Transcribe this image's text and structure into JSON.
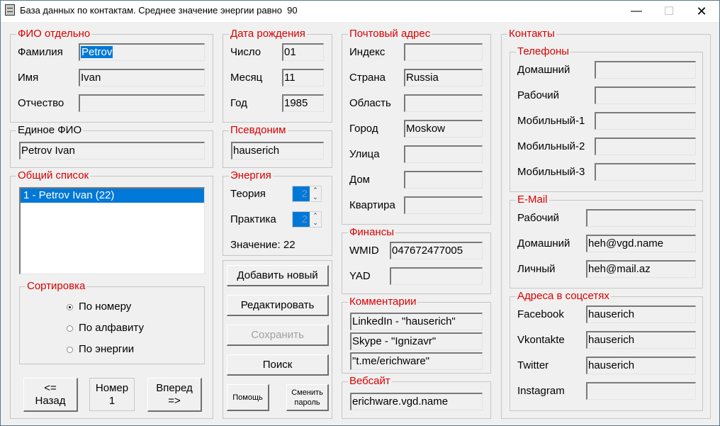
{
  "window": {
    "title": "База данных по контактам. Среднее значение энергии равно  90",
    "controls": {
      "minimize": "—",
      "maximize": "☐",
      "close": "✕"
    }
  },
  "fio": {
    "legend": "ФИО отдельно",
    "last_name_label": "Фамилия",
    "last_name_value": "Petrov",
    "first_name_label": "Имя",
    "first_name_value": "Ivan",
    "patronymic_label": "Отчество",
    "patronymic_value": ""
  },
  "full_name": {
    "legend": "Единое ФИО",
    "value": "Petrov Ivan"
  },
  "general_list": {
    "legend": "Общий список",
    "items": [
      "1 - Petrov Ivan (22)"
    ],
    "sort": {
      "legend": "Сортировка",
      "options": [
        "По номеру",
        "По алфавиту",
        "По энергии"
      ],
      "selected": "По номеру"
    },
    "nav": {
      "back": "<=\nНазад",
      "number_label": "Номер",
      "number_value": "1",
      "forward": "Вперед\n=>"
    }
  },
  "birth_date": {
    "legend": "Дата рождения",
    "day_label": "Число",
    "day_value": "01",
    "month_label": "Месяц",
    "month_value": "11",
    "year_label": "Год",
    "year_value": "1985"
  },
  "nickname": {
    "legend": "Псевдоним",
    "value": "hauserich"
  },
  "energy": {
    "legend": "Энергия",
    "theory_label": "Теория",
    "theory_value": "2",
    "practice_label": "Практика",
    "practice_value": "2",
    "result_text": "Значение: 22"
  },
  "actions": {
    "add": "Добавить новый",
    "edit": "Редактировать",
    "save": "Сохранить",
    "search": "Поиск",
    "help": "Помощь",
    "change_password": "Сменить пароль"
  },
  "postal": {
    "legend": "Почтовый адрес",
    "fields": [
      {
        "label": "Индекс",
        "value": ""
      },
      {
        "label": "Страна",
        "value": "Russia"
      },
      {
        "label": "Область",
        "value": ""
      },
      {
        "label": "Город",
        "value": "Moskow"
      },
      {
        "label": "Улица",
        "value": ""
      },
      {
        "label": "Дом",
        "value": ""
      },
      {
        "label": "Квартира",
        "value": ""
      }
    ]
  },
  "finance": {
    "legend": "Финансы",
    "fields": [
      {
        "label": "WMID",
        "value": "047672477005"
      },
      {
        "label": "YAD",
        "value": ""
      }
    ]
  },
  "comments": {
    "legend": "Комментарии",
    "lines": [
      "LinkedIn - \"hauserich\"",
      "Skype - \"Ignizavr\"",
      "\"t.me/erichware\""
    ]
  },
  "website": {
    "legend": "Вебсайт",
    "value": "erichware.vgd.name"
  },
  "contacts": {
    "legend": "Контакты",
    "phones": {
      "legend": "Телефоны",
      "fields": [
        {
          "label": "Домашний",
          "value": ""
        },
        {
          "label": "Рабочий",
          "value": ""
        },
        {
          "label": "Мобильный-1",
          "value": ""
        },
        {
          "label": "Мобильный-2",
          "value": ""
        },
        {
          "label": "Мобильный-3",
          "value": ""
        }
      ]
    },
    "email": {
      "legend": "E-Mail",
      "fields": [
        {
          "label": "Рабочий",
          "value": ""
        },
        {
          "label": "Домашний",
          "value": "heh@vgd.name"
        },
        {
          "label": "Личный",
          "value": "heh@mail.az"
        }
      ]
    },
    "social": {
      "legend": "Адреса в соцсетях",
      "fields": [
        {
          "label": "Facebook",
          "value": "hauserich"
        },
        {
          "label": "Vkontakte",
          "value": "hauserich"
        },
        {
          "label": "Twitter",
          "value": "hauserich"
        },
        {
          "label": "Instagram",
          "value": ""
        }
      ]
    }
  }
}
